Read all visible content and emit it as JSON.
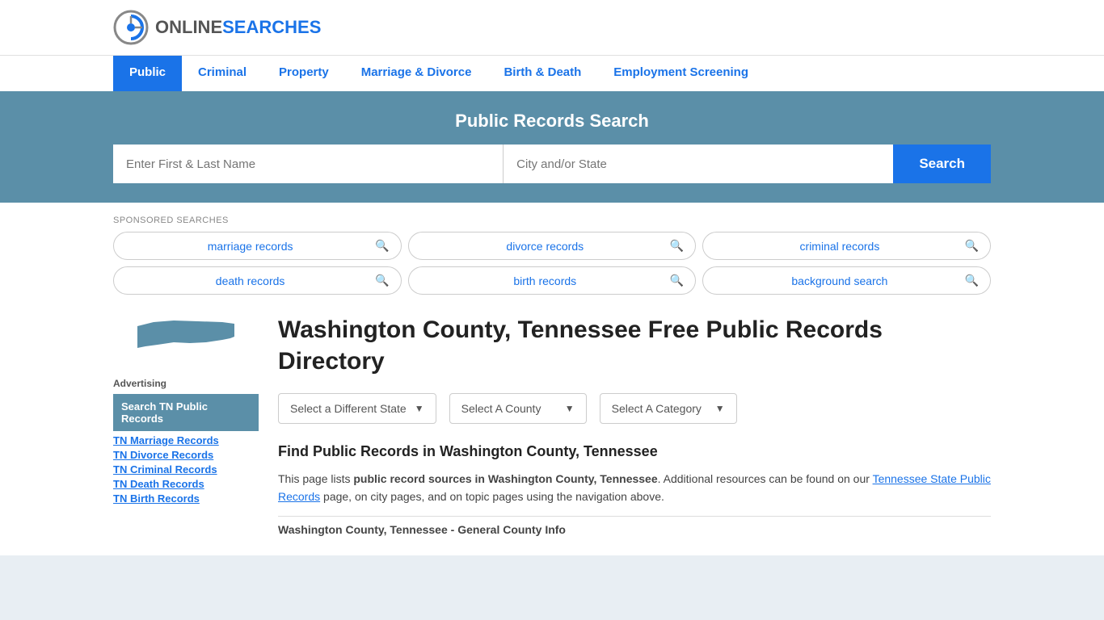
{
  "header": {
    "logo_text_gray": "ONLINE",
    "logo_text_blue": "SEARCHES"
  },
  "nav": {
    "items": [
      {
        "label": "Public",
        "active": true
      },
      {
        "label": "Criminal",
        "active": false
      },
      {
        "label": "Property",
        "active": false
      },
      {
        "label": "Marriage & Divorce",
        "active": false
      },
      {
        "label": "Birth & Death",
        "active": false
      },
      {
        "label": "Employment Screening",
        "active": false
      }
    ]
  },
  "search_banner": {
    "title": "Public Records Search",
    "name_placeholder": "Enter First & Last Name",
    "location_placeholder": "City and/or State",
    "button_label": "Search"
  },
  "sponsored": {
    "label": "SPONSORED SEARCHES",
    "pills": [
      {
        "text": "marriage records"
      },
      {
        "text": "divorce records"
      },
      {
        "text": "criminal records"
      },
      {
        "text": "death records"
      },
      {
        "text": "birth records"
      },
      {
        "text": "background search"
      }
    ]
  },
  "sidebar": {
    "advertising_label": "Advertising",
    "ad_item": "Search TN Public Records",
    "links": [
      "TN Marriage Records",
      "TN Divorce Records",
      "TN Criminal Records",
      "TN Death Records",
      "TN Birth Records"
    ]
  },
  "article": {
    "title": "Washington County, Tennessee Free Public Records Directory",
    "dropdowns": [
      {
        "label": "Select a Different State"
      },
      {
        "label": "Select A County"
      },
      {
        "label": "Select A Category"
      }
    ],
    "find_title": "Find Public Records in Washington County, Tennessee",
    "find_description_part1": "This page lists ",
    "find_description_bold1": "public record sources in Washington County, Tennessee",
    "find_description_part2": ". Additional resources can be found on our ",
    "find_link": "Tennessee State Public Records",
    "find_description_part3": " page, on city pages, and on topic pages using the navigation above.",
    "section_subtitle": "Washington County, Tennessee - General County Info"
  },
  "colors": {
    "blue": "#1a73e8",
    "banner_bg": "#5b8fa8",
    "nav_active_bg": "#1a73e8",
    "sidebar_ad_bg": "#5b8fa8",
    "state_fill": "#5b8fa8"
  }
}
